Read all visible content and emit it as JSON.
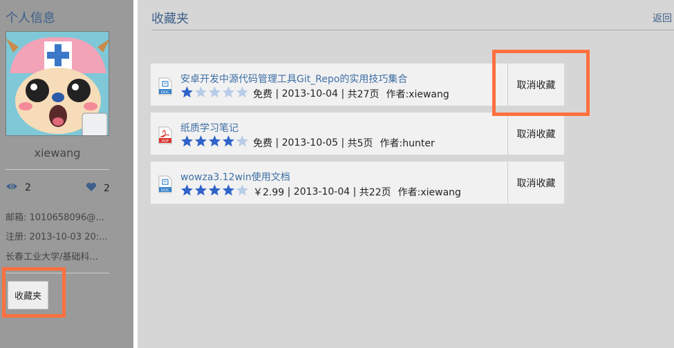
{
  "sidebar": {
    "title": "个人信息",
    "username": "xiewang",
    "views": "2",
    "likes": "2",
    "email": "邮箱: 1010658096@...",
    "registered": "注册: 2013-10-03 20:...",
    "school": "长春工业大学/基础科...",
    "favorites_button": "收藏夹"
  },
  "main": {
    "title": "收藏夹",
    "back": "返回",
    "items": [
      {
        "title": "安卓开发中源代码管理工具Git_Repo的实用技巧集合",
        "type": "DOC",
        "rating": 1,
        "price": "免费",
        "date": "2013-10-04",
        "pages": "共27页",
        "author": "作者:xiewang",
        "action": "取消收藏"
      },
      {
        "title": "纸质学习笔记",
        "type": "PDF",
        "rating": 4,
        "price": "免费",
        "date": "2013-10-05",
        "pages": "共5页",
        "author": "作者:hunter",
        "action": "取消收藏"
      },
      {
        "title": "wowza3.12win使用文档",
        "type": "DOC",
        "rating": 4,
        "price": "￥2.99",
        "date": "2013-10-04",
        "pages": "共22页",
        "author": "作者:xiewang",
        "action": "取消收藏"
      }
    ]
  },
  "colors": {
    "accent_link": "#3d6ea5",
    "highlight": "#ff7040",
    "star_filled": "#2f63c9",
    "star_empty": "#b8cbe8"
  }
}
